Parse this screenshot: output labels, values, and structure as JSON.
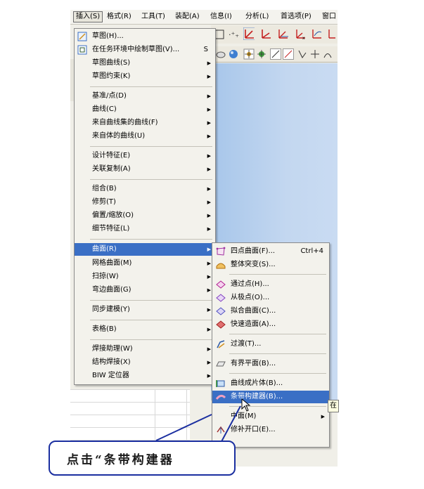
{
  "menubar": {
    "items": [
      "插入(S)",
      "格式(R)",
      "工具(T)",
      "装配(A)",
      "信息(I)",
      "分析(L)",
      "首选项(P)",
      "窗口"
    ]
  },
  "insert_menu": {
    "items": [
      {
        "label": "草图(H)...",
        "icon": "sketch-icon"
      },
      {
        "label": "在任务环境中绘制草图(V)...",
        "shortcut": "S",
        "icon": "sketch-task-icon"
      },
      {
        "label": "草图曲线(S)",
        "submenu": true
      },
      {
        "label": "草图约束(K)",
        "submenu": true
      },
      {
        "label": "基准/点(D)",
        "submenu": true
      },
      {
        "label": "曲线(C)",
        "submenu": true
      },
      {
        "label": "来自曲线集的曲线(F)",
        "submenu": true
      },
      {
        "label": "来自体的曲线(U)",
        "submenu": true
      },
      {
        "label": "设计特征(E)",
        "submenu": true
      },
      {
        "label": "关联复制(A)",
        "submenu": true
      },
      {
        "label": "组合(B)",
        "submenu": true
      },
      {
        "label": "修剪(T)",
        "submenu": true
      },
      {
        "label": "偏置/缩放(O)",
        "submenu": true
      },
      {
        "label": "细节特征(L)",
        "submenu": true
      },
      {
        "label": "曲面(R)",
        "submenu": true
      },
      {
        "label": "网格曲面(M)",
        "submenu": true
      },
      {
        "label": "扫掠(W)",
        "submenu": true
      },
      {
        "label": "弯边曲面(G)",
        "submenu": true
      },
      {
        "label": "同步建模(Y)",
        "submenu": true
      },
      {
        "label": "表格(B)",
        "submenu": true
      },
      {
        "label": "焊接助理(W)",
        "submenu": true
      },
      {
        "label": "结构焊接(X)",
        "submenu": true
      },
      {
        "label": "BIW 定位器",
        "submenu": true
      }
    ]
  },
  "surface_menu": {
    "items": [
      {
        "label": "四点曲面(F)...",
        "shortcut": "Ctrl+4",
        "icon": "four-point-surface-icon"
      },
      {
        "label": "整体突变(S)...",
        "icon": "rapid-surface-icon"
      },
      {
        "label": "通过点(H)...",
        "icon": "through-points-icon"
      },
      {
        "label": "从极点(O)...",
        "icon": "from-poles-icon"
      },
      {
        "label": "拟合曲面(C)...",
        "icon": "fit-surface-icon"
      },
      {
        "label": "快速造面(A)...",
        "icon": "rapid-surfacing-icon"
      },
      {
        "label": "过渡(T)...",
        "icon": "transition-icon"
      },
      {
        "label": "有界平面(B)...",
        "icon": "bounded-plane-icon"
      },
      {
        "label": "曲线成片体(B)...",
        "icon": "curve-to-sheet-icon"
      },
      {
        "label": "条带构建器(B)...",
        "icon": "ribbon-builder-icon"
      },
      {
        "label": "中面(M)",
        "icon": "midsurface-icon",
        "submenu": true
      },
      {
        "label": "修补开口(E)...",
        "icon": "patch-openings-icon"
      }
    ]
  },
  "tooltip": {
    "text": "在"
  },
  "annotation": {
    "text": "点击“条带构建器"
  },
  "colors": {
    "highlight": "#3a6fc5",
    "annotation_border": "#1b2fa0",
    "viewport": "#b8d0ee"
  }
}
